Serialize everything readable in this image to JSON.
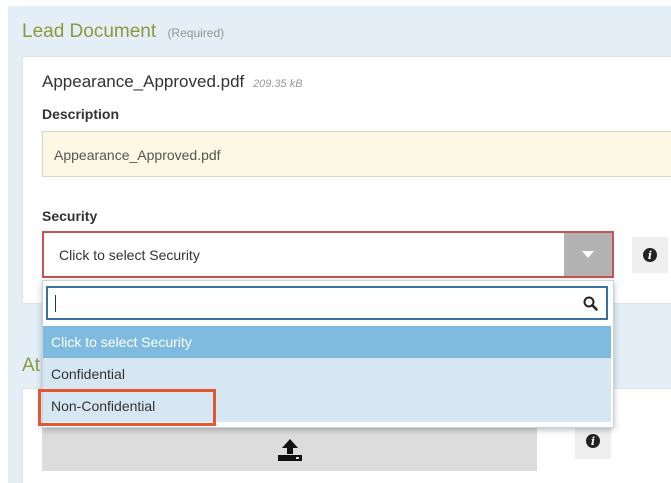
{
  "lead_document": {
    "title": "Lead Document",
    "required_note": "(Required)",
    "file_name": "Appearance_Approved.pdf",
    "file_size": "209.35 kB",
    "description_label": "Description",
    "description_value": "Appearance_Approved.pdf",
    "security_label": "Security",
    "security_selected": "Click to select Security",
    "info_icon": "i"
  },
  "security_dropdown": {
    "search_value": "",
    "options": [
      "Click to select Security",
      "Confidential",
      "Non-Confidential"
    ]
  },
  "attachments": {
    "title_fragment": "At",
    "info_icon": "i"
  },
  "colors": {
    "panel_bg": "#e3eef7",
    "title_green": "#8a9a3c",
    "description_bg": "#fcf8e3",
    "error_border": "#c9534f",
    "option_selected_bg": "#7fbadf",
    "option_bg": "#d6e6f2",
    "highlight": "#e2572f"
  }
}
